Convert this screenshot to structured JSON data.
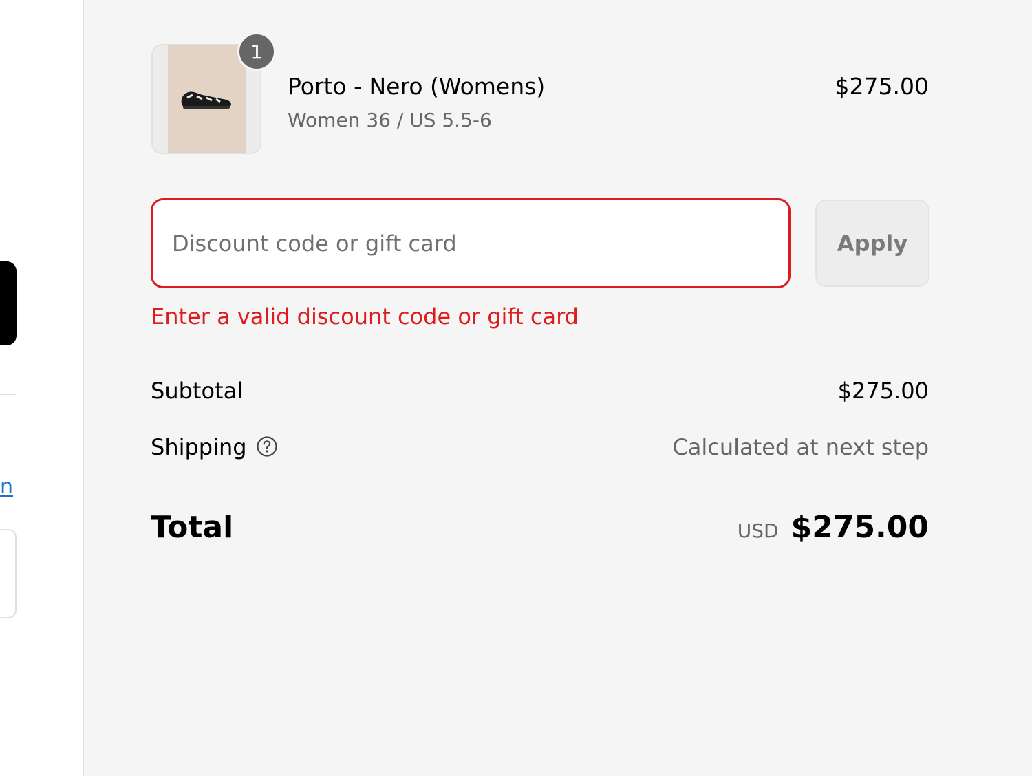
{
  "left_panel": {
    "link_text": "n"
  },
  "cart": {
    "item": {
      "quantity": "1",
      "name": "Porto - Nero (Womens)",
      "variant": "Women 36 / US 5.5-6",
      "price": "$275.00",
      "image_icon": "shoe-icon"
    }
  },
  "discount": {
    "placeholder": "Discount code or gift card",
    "value": "",
    "apply_label": "Apply",
    "error": "Enter a valid discount code or gift card"
  },
  "summary": {
    "subtotal_label": "Subtotal",
    "subtotal_value": "$275.00",
    "shipping_label": "Shipping",
    "shipping_value": "Calculated at next step",
    "shipping_help_icon": "question-circle-icon",
    "total_label": "Total",
    "currency": "USD",
    "total_value": "$275.00"
  },
  "colors": {
    "error": "#dd1d1d",
    "background": "#f5f5f5",
    "link": "#1a73c8"
  }
}
